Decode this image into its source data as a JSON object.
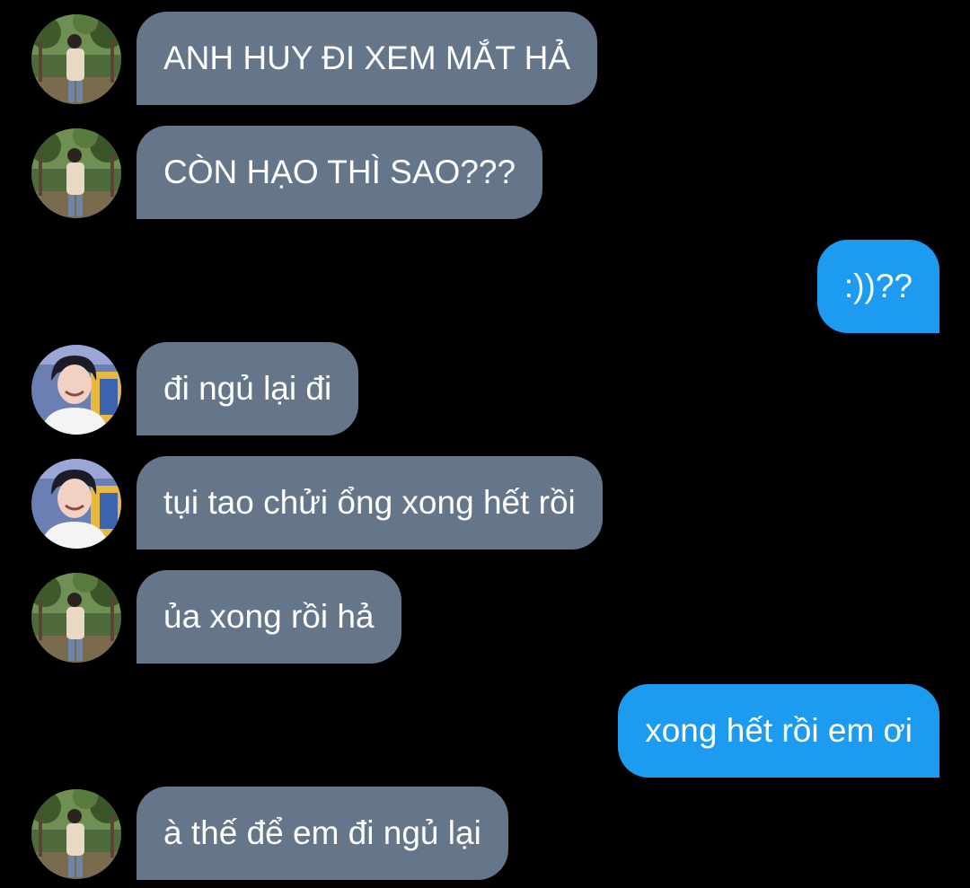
{
  "conversation": {
    "messages": [
      {
        "sender": "contact-a",
        "text": "ANH HUY ĐI XEM MẮT HẢ"
      },
      {
        "sender": "contact-a",
        "text": "CÒN HẠO THÌ SAO???"
      },
      {
        "sender": "me",
        "text": ":))??"
      },
      {
        "sender": "contact-b",
        "text": "đi ngủ lại đi"
      },
      {
        "sender": "contact-b",
        "text": "tụi tao chửi ổng xong hết rồi"
      },
      {
        "sender": "contact-a",
        "text": "ủa xong rồi hả"
      },
      {
        "sender": "me",
        "text": "xong hết rồi em ơi"
      },
      {
        "sender": "contact-a",
        "text": "à thế để em đi ngủ lại"
      }
    ]
  },
  "colors": {
    "background": "#000000",
    "incoming_bubble": "#66768a",
    "outgoing_bubble": "#1d9bf0",
    "text": "#ffffff"
  }
}
